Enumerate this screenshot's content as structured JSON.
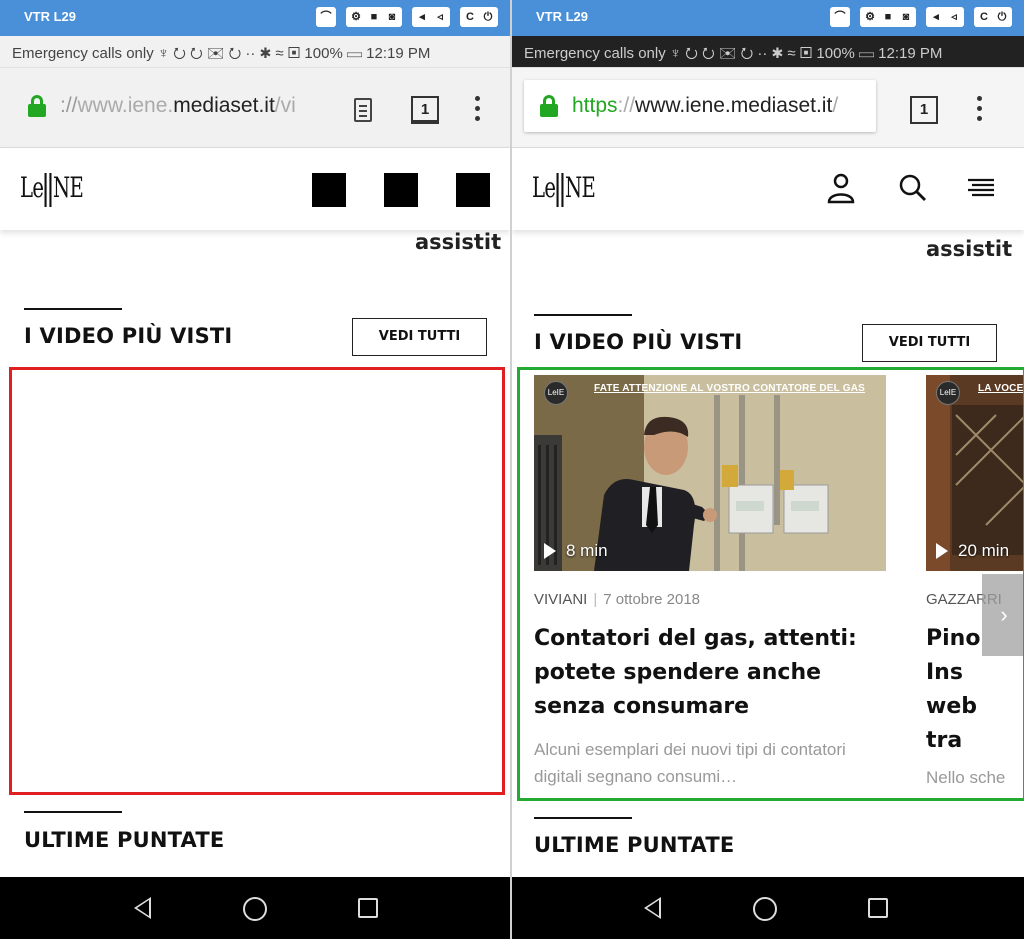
{
  "system": {
    "window_title": "VTR L29",
    "status_text": "Emergency calls only ♆ ⭮ ⭮ ✉ ⭮ ·· ✱ ≈ ▣ 100% ▭ 12:19 PM"
  },
  "left": {
    "url": {
      "scheme": "://",
      "domain_pre": "www.iene.",
      "domain_main": "mediaset.it",
      "rest": "/vi"
    },
    "tab_count": "1",
    "partial_heading": "assistit",
    "section_most_viewed": "I VIDEO PIÙ VISTI",
    "see_all": "VEDI TUTTI",
    "section_latest": "ULTIME PUNTATE"
  },
  "right": {
    "url": {
      "scheme": "https",
      "sep": "://",
      "domain_pre": "www.iene.",
      "domain_main": "mediaset.it",
      "rest": "/"
    },
    "tab_count": "1",
    "partial_heading": "assistit",
    "section_most_viewed": "I VIDEO PIÙ VISTI",
    "see_all": "VEDI TUTTI",
    "section_latest": "ULTIME PUNTATE",
    "cards": [
      {
        "thumb_caption": "FATE ATTENZIONE AL VOSTRO CONTATORE DEL GAS",
        "duration": "8 min",
        "author": "VIVIANI",
        "date": "7 ottobre 2018",
        "title": "Contatori del gas, attenti: potete spendere anche senza consumare",
        "description": "Alcuni esemplari dei nuovi tipi di contatori digitali segnano consumi…"
      },
      {
        "thumb_caption": "LA VOCE",
        "duration": "20 min",
        "author": "GAZZARRI",
        "title": "Pino Ins web tra",
        "description": "Nello sche abbiamo f"
      }
    ]
  },
  "colors": {
    "title_bar": "#4a90d9",
    "lock_green": "#22a722",
    "empty_carousel_border": "#e02020",
    "filled_carousel_border": "#22aa33"
  }
}
